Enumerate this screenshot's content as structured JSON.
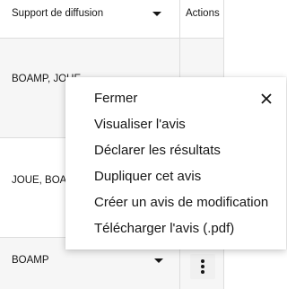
{
  "table": {
    "headers": {
      "support": "Support de diffusion",
      "actions": "Actions"
    },
    "rows": [
      {
        "support": "BOAMP, JOUE"
      },
      {
        "support": "JOUE, BOAMP"
      },
      {
        "support": "BOAMP"
      }
    ]
  },
  "menu": {
    "items": [
      "Fermer",
      "Visualiser l'avis",
      "Déclarer les résultats",
      "Dupliquer cet avis",
      "Créer un avis de modification",
      "Télécharger l'avis (.pdf)"
    ]
  },
  "icons": {
    "close": "close-icon",
    "sort": "chevron-down-icon",
    "more": "more-vertical-icon"
  }
}
